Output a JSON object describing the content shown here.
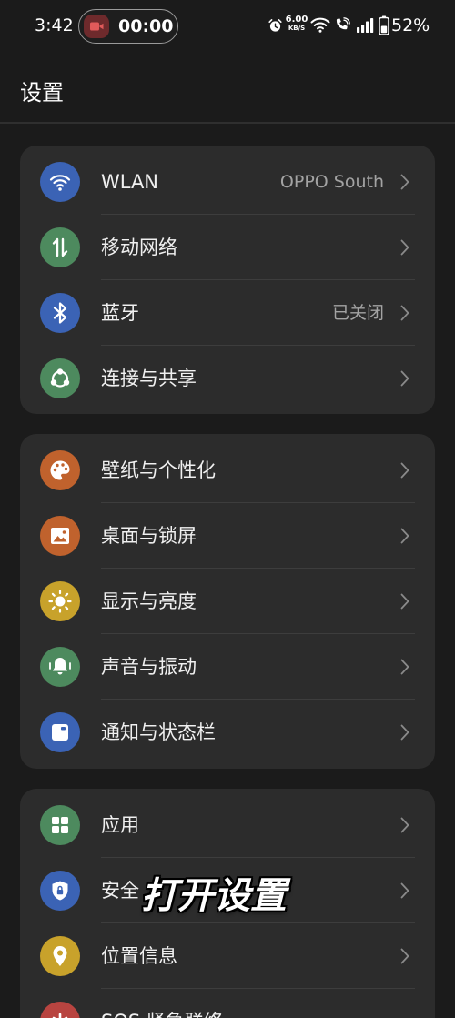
{
  "status_bar": {
    "time": "3:42",
    "screen_record_timer": "00:00",
    "net_speed_value": "6.00",
    "net_speed_unit": "KB/S",
    "battery_percent_label": "52%",
    "battery_level": 0.52,
    "record_color": "#6e2a2c",
    "icons": [
      "screen-record-icon",
      "alarm-icon",
      "wifi-status-icon",
      "wifi-calling-icon",
      "signal-icon",
      "battery-icon"
    ]
  },
  "header": {
    "title": "设置"
  },
  "groups": [
    {
      "items": [
        {
          "label": "WLAN",
          "value": "OPPO South",
          "icon": "wifi-icon",
          "icon_color": "#3b63b5"
        },
        {
          "label": "移动网络",
          "icon": "mobile-network-icon",
          "icon_color": "#4d8a5e"
        },
        {
          "label": "蓝牙",
          "value": "已关闭",
          "icon": "bluetooth-icon",
          "icon_color": "#3b63b5"
        },
        {
          "label": "连接与共享",
          "icon": "connection-sharing-icon",
          "icon_color": "#4d8a5e"
        }
      ]
    },
    {
      "items": [
        {
          "label": "壁纸与个性化",
          "icon": "palette-icon",
          "icon_color": "#c0622d"
        },
        {
          "label": "桌面与锁屏",
          "icon": "picture-icon",
          "icon_color": "#c0622d"
        },
        {
          "label": "显示与亮度",
          "icon": "sun-icon",
          "icon_color": "#c8a22b"
        },
        {
          "label": "声音与振动",
          "icon": "bell-icon",
          "icon_color": "#4d8a5e"
        },
        {
          "label": "通知与状态栏",
          "icon": "notification-icon",
          "icon_color": "#3b63b5"
        }
      ]
    },
    {
      "items": [
        {
          "label": "应用",
          "icon": "apps-grid-icon",
          "icon_color": "#4d8a5e"
        },
        {
          "label": "安全",
          "icon": "shield-lock-icon",
          "icon_color": "#3b63b5"
        },
        {
          "label": "位置信息",
          "icon": "location-pin-icon",
          "icon_color": "#c8a22b"
        },
        {
          "label": "SOS 紧急联络",
          "icon": "sos-icon",
          "icon_color": "#b84440"
        }
      ]
    }
  ],
  "overlay": {
    "caption": "打开设置"
  },
  "colors": {
    "background": "#1b1b1b",
    "card": "#2c2c2c",
    "divider": "#3d3d3d",
    "text_primary": "#f0f0f0",
    "text_secondary": "#a3a3a3",
    "chevron": "#8a8a8a"
  }
}
